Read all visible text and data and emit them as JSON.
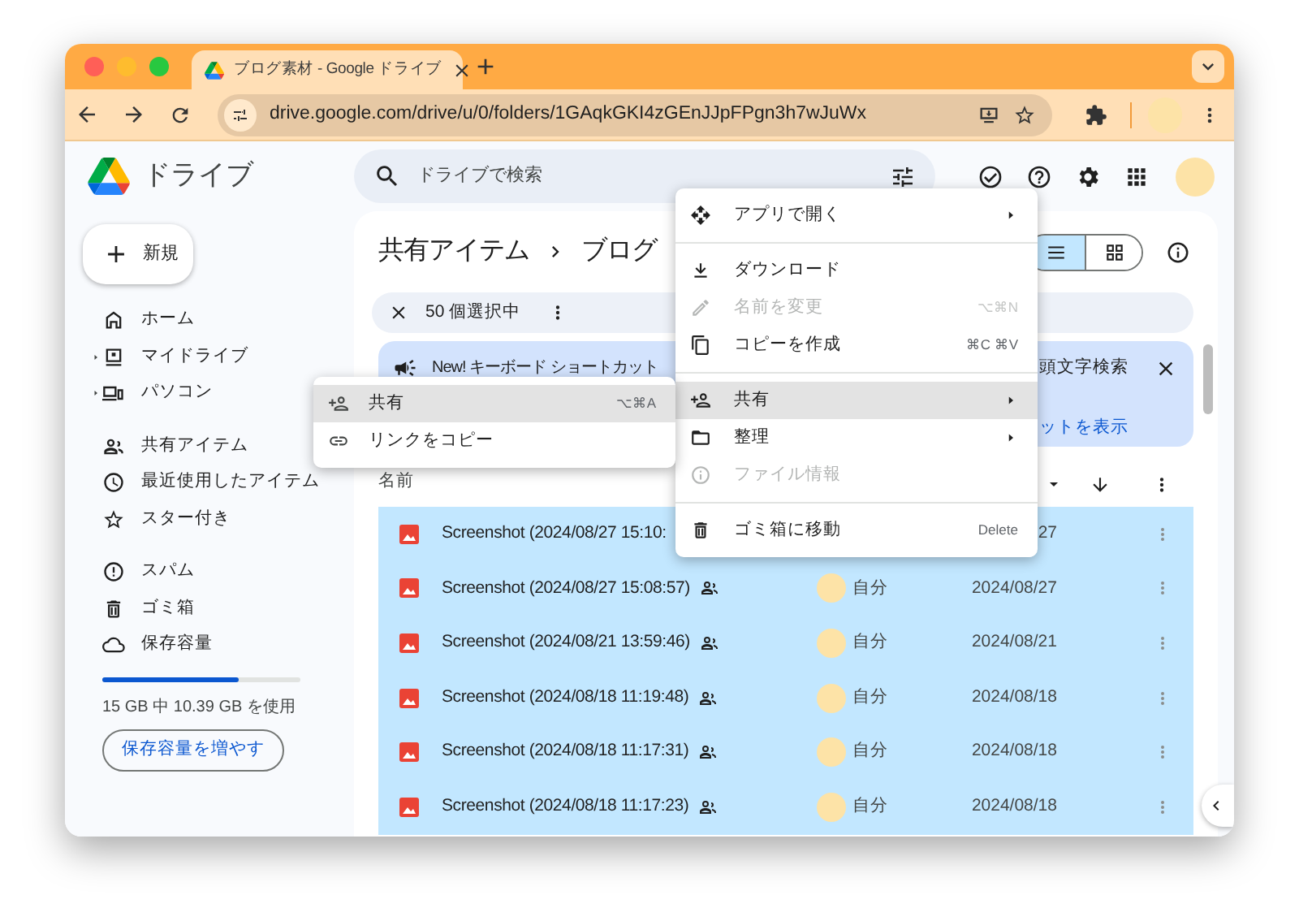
{
  "browser": {
    "tabs": [
      {
        "title": "ブログ素材 - Google ドライブ",
        "selected": true
      }
    ],
    "url": "drive.google.com/drive/u/0/folders/1GAqkGKI4zGEnJJpFPgn3h7wJuWx"
  },
  "app": {
    "name": "ドライブ"
  },
  "search": {
    "placeholder": "ドライブで検索"
  },
  "new_button": {
    "label": "新規"
  },
  "sidebar": {
    "groups": [
      [
        {
          "label": "ホーム",
          "expandable": false
        },
        {
          "label": "マイドライブ",
          "expandable": true
        },
        {
          "label": "パソコン",
          "expandable": true
        }
      ],
      [
        {
          "label": "共有アイテム",
          "expandable": false
        },
        {
          "label": "最近使用したアイテム",
          "expandable": false
        },
        {
          "label": "スター付き",
          "expandable": false
        }
      ],
      [
        {
          "label": "スパム",
          "expandable": false
        },
        {
          "label": "ゴミ箱",
          "expandable": false
        },
        {
          "label": "保存容量",
          "expandable": false
        }
      ]
    ]
  },
  "storage": {
    "level": 0.69,
    "text": "15 GB 中 10.39 GB を使用",
    "button": "保存容量を増やす"
  },
  "breadcrumb": [
    "共有アイテム",
    "ブログ"
  ],
  "view_toggle": [
    {
      "selected": true
    },
    {
      "selected": false
    }
  ],
  "selection_bar": {
    "count": "50 個選択中"
  },
  "banner": {
    "text": "New! キーボード ショートカット",
    "text_right": "頭文字検索",
    "link": "ットを表示"
  },
  "table": {
    "columns": [
      "名前"
    ],
    "rows": [
      {
        "name": "Screenshot (2024/08/27 15:10:",
        "date": "27",
        "selected": true
      },
      {
        "name": "Screenshot (2024/08/27 15:08:57)",
        "shared": true,
        "owner": "自分",
        "date": "2024/08/27",
        "selected": true
      },
      {
        "name": "Screenshot (2024/08/21 13:59:46)",
        "shared": true,
        "owner": "自分",
        "date": "2024/08/21",
        "selected": true
      },
      {
        "name": "Screenshot (2024/08/18 11:19:48)",
        "shared": true,
        "owner": "自分",
        "date": "2024/08/18",
        "selected": true
      },
      {
        "name": "Screenshot (2024/08/18 11:17:31)",
        "shared": true,
        "owner": "自分",
        "date": "2024/08/18",
        "selected": true
      },
      {
        "name": "Screenshot (2024/08/18 11:17:23)",
        "shared": true,
        "owner": "自分",
        "date": "2024/08/18",
        "selected": true
      }
    ]
  },
  "context_menu": {
    "items": [
      {
        "kind": "item",
        "label": "アプリで開く",
        "submenu": true,
        "disabled": false,
        "highlighted": false
      },
      {
        "kind": "divider"
      },
      {
        "kind": "item",
        "label": "ダウンロード",
        "submenu": false,
        "disabled": false,
        "highlighted": false
      },
      {
        "kind": "item",
        "label": "名前を変更",
        "shortcut": "⌥⌘N",
        "submenu": false,
        "disabled": true,
        "highlighted": false
      },
      {
        "kind": "item",
        "label": "コピーを作成",
        "shortcut": "⌘C ⌘V",
        "submenu": false,
        "disabled": false,
        "highlighted": false
      },
      {
        "kind": "divider"
      },
      {
        "kind": "item",
        "label": "共有",
        "submenu": true,
        "disabled": false,
        "highlighted": true
      },
      {
        "kind": "item",
        "label": "整理",
        "submenu": true,
        "disabled": false,
        "highlighted": false
      },
      {
        "kind": "item",
        "label": "ファイル情報",
        "submenu": false,
        "disabled": true,
        "highlighted": false
      },
      {
        "kind": "divider"
      },
      {
        "kind": "item",
        "label": "ゴミ箱に移動",
        "shortcut": "Delete",
        "submenu": false,
        "disabled": false,
        "highlighted": false
      }
    ]
  },
  "submenu": {
    "items": [
      {
        "label": "共有",
        "shortcut": "⌥⌘A",
        "highlighted": true
      },
      {
        "label": "リンクをコピー",
        "highlighted": false
      }
    ]
  }
}
